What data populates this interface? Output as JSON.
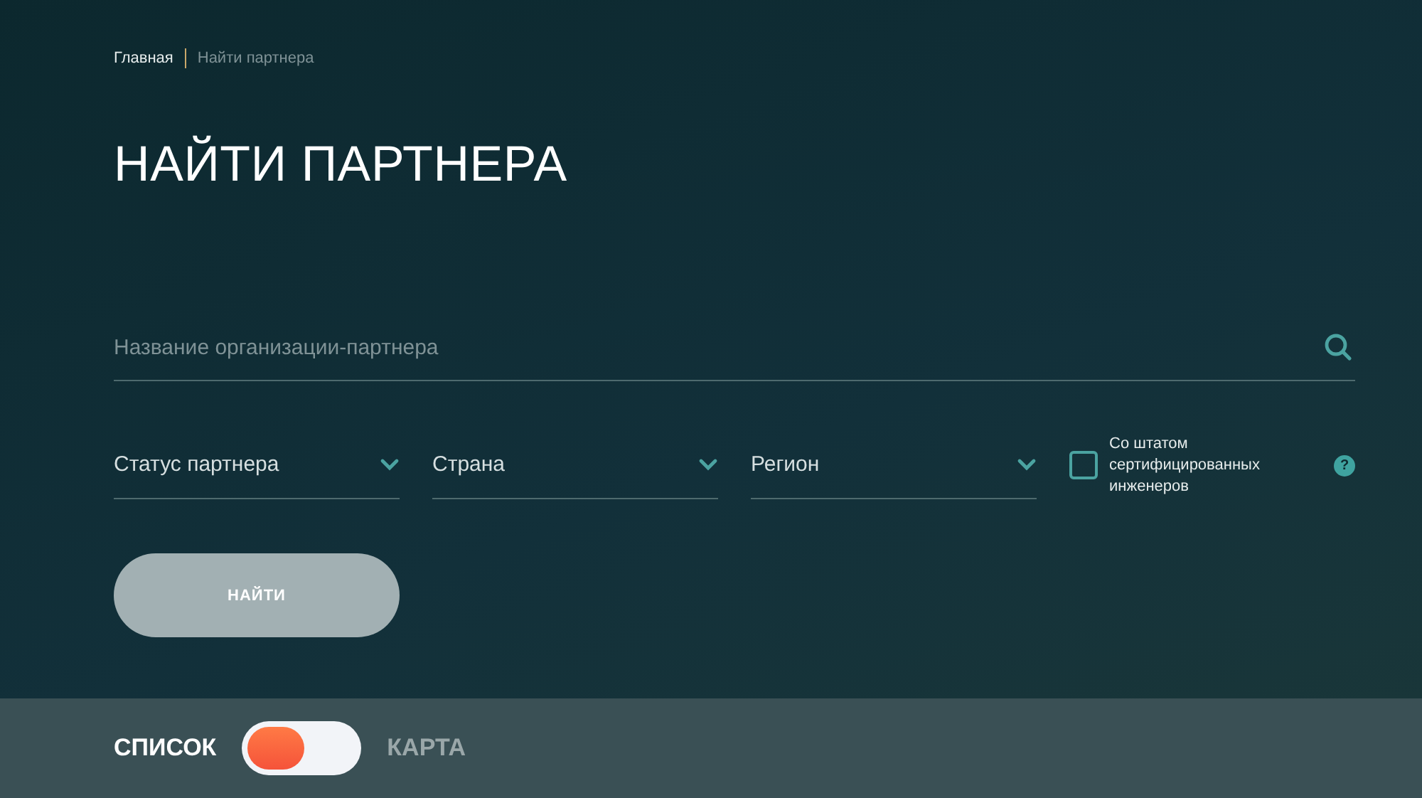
{
  "breadcrumb": [
    {
      "label": "Главная",
      "current": false
    },
    {
      "label": "Найти партнера",
      "current": true
    }
  ],
  "title": "НАЙТИ ПАРТНЕРА",
  "search": {
    "placeholder": "Название организации-партнера"
  },
  "filters": [
    {
      "label": "Статус партнера"
    },
    {
      "label": "Страна"
    },
    {
      "label": "Регион"
    }
  ],
  "certified": {
    "label": "Со штатом сертифицированных инженеров",
    "checked": false,
    "help": "?"
  },
  "submit": {
    "label": "НАЙТИ",
    "disabled": true
  },
  "views": [
    {
      "label": "СПИСОК",
      "selected": true
    },
    {
      "label": "КАРТА",
      "selected": false
    }
  ]
}
